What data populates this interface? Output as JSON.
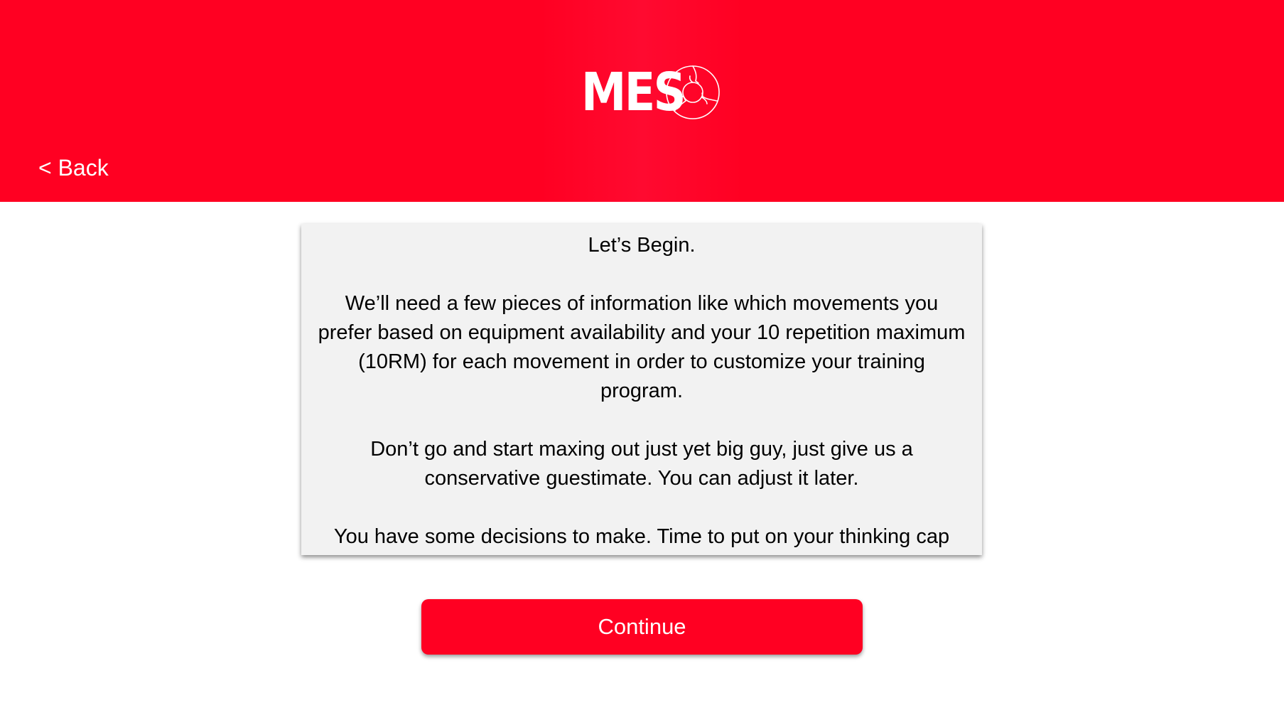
{
  "header": {
    "logo_text": "MES",
    "logo_mark_icon": "circular-segment-logo-icon",
    "back_label": "< Back",
    "background_color": "#ff0022"
  },
  "info_card": {
    "heading": "Let’s Begin.",
    "paragraph_1": "We’ll need a few pieces of information like which movements you prefer based on equipment availability and your 10 repetition maximum (10RM) for each movement in order to customize your training program.",
    "paragraph_2": "Don’t go and start maxing out just yet big guy, just give us a conservative guestimate. You can adjust it later.",
    "paragraph_3": "You have some decisions to make. Time to put on your thinking cap",
    "background_color": "#f2f2f2"
  },
  "actions": {
    "continue_label": "Continue",
    "accent_color": "#ff0022"
  }
}
